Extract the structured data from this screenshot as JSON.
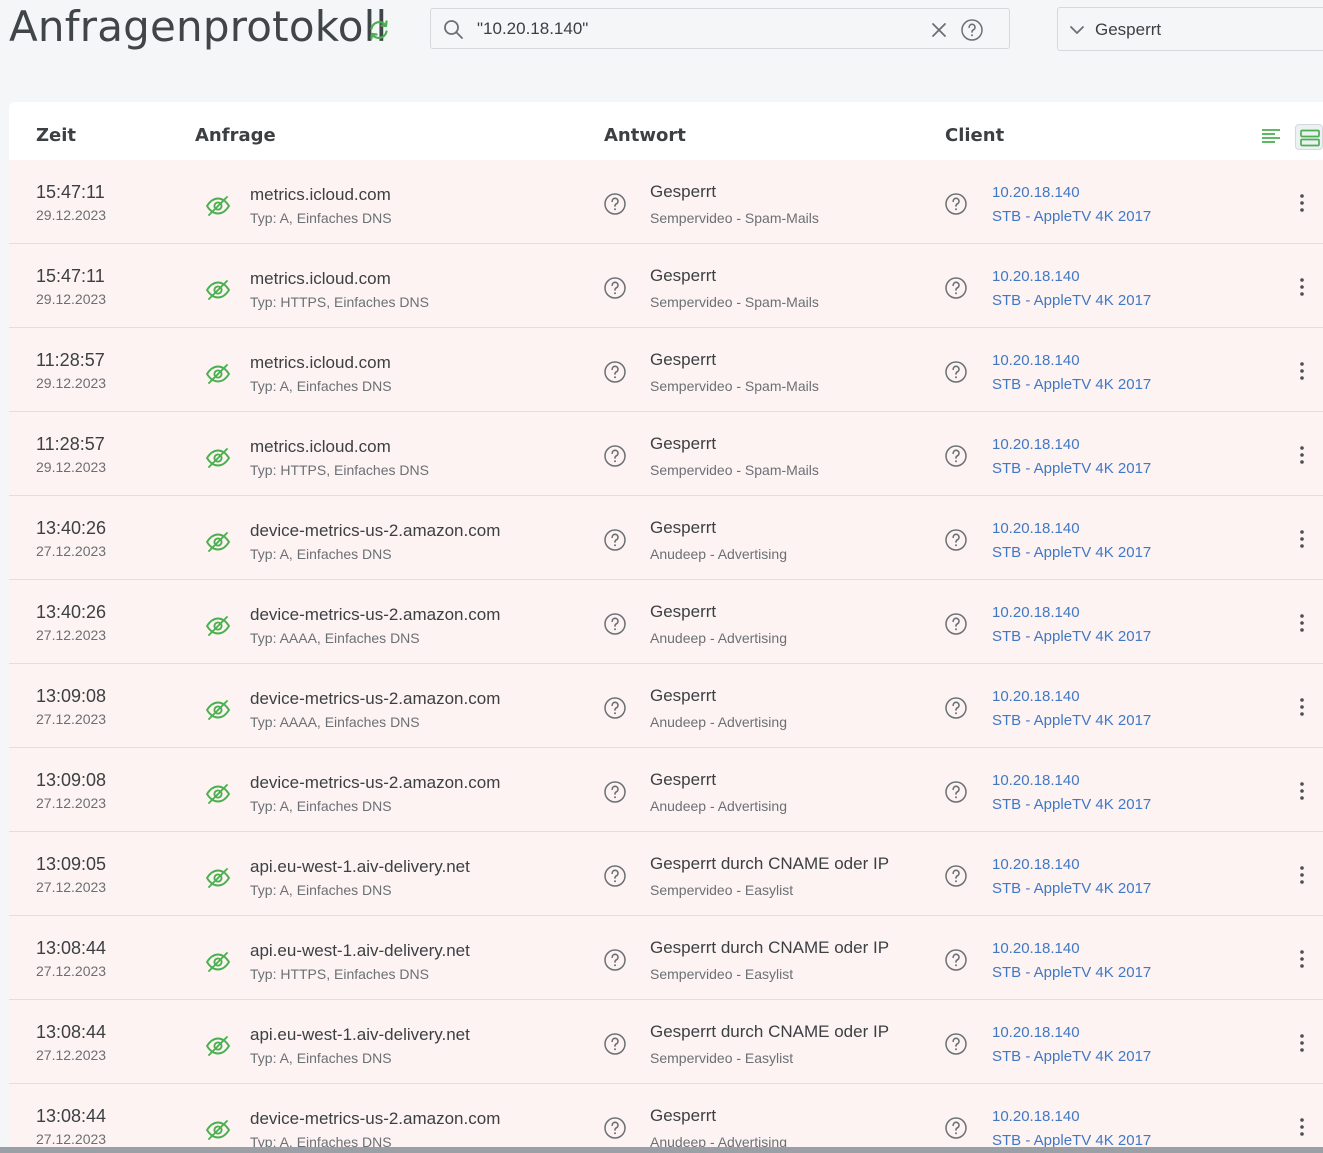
{
  "header": {
    "title": "Anfragenprotokoll",
    "search_value": "\"10.20.18.140\"",
    "filter_value": "Gesperrt",
    "accent_color": "#4caf50"
  },
  "table": {
    "columns": [
      "Zeit",
      "Anfrage",
      "Antwort",
      "Client"
    ],
    "rows": [
      {
        "time": "15:47:11",
        "date": "29.12.2023",
        "domain": "metrics.icloud.com",
        "type": "Typ: A, Einfaches DNS",
        "status": "Gesperrt",
        "list": "Sempervideo - Spam-Mails",
        "ip": "10.20.18.140",
        "client": "STB - AppleTV 4K 2017"
      },
      {
        "time": "15:47:11",
        "date": "29.12.2023",
        "domain": "metrics.icloud.com",
        "type": "Typ: HTTPS, Einfaches DNS",
        "status": "Gesperrt",
        "list": "Sempervideo - Spam-Mails",
        "ip": "10.20.18.140",
        "client": "STB - AppleTV 4K 2017"
      },
      {
        "time": "11:28:57",
        "date": "29.12.2023",
        "domain": "metrics.icloud.com",
        "type": "Typ: A, Einfaches DNS",
        "status": "Gesperrt",
        "list": "Sempervideo - Spam-Mails",
        "ip": "10.20.18.140",
        "client": "STB - AppleTV 4K 2017"
      },
      {
        "time": "11:28:57",
        "date": "29.12.2023",
        "domain": "metrics.icloud.com",
        "type": "Typ: HTTPS, Einfaches DNS",
        "status": "Gesperrt",
        "list": "Sempervideo - Spam-Mails",
        "ip": "10.20.18.140",
        "client": "STB - AppleTV 4K 2017"
      },
      {
        "time": "13:40:26",
        "date": "27.12.2023",
        "domain": "device-metrics-us-2.amazon.com",
        "type": "Typ: A, Einfaches DNS",
        "status": "Gesperrt",
        "list": "Anudeep - Advertising",
        "ip": "10.20.18.140",
        "client": "STB - AppleTV 4K 2017"
      },
      {
        "time": "13:40:26",
        "date": "27.12.2023",
        "domain": "device-metrics-us-2.amazon.com",
        "type": "Typ: AAAA, Einfaches DNS",
        "status": "Gesperrt",
        "list": "Anudeep - Advertising",
        "ip": "10.20.18.140",
        "client": "STB - AppleTV 4K 2017"
      },
      {
        "time": "13:09:08",
        "date": "27.12.2023",
        "domain": "device-metrics-us-2.amazon.com",
        "type": "Typ: AAAA, Einfaches DNS",
        "status": "Gesperrt",
        "list": "Anudeep - Advertising",
        "ip": "10.20.18.140",
        "client": "STB - AppleTV 4K 2017"
      },
      {
        "time": "13:09:08",
        "date": "27.12.2023",
        "domain": "device-metrics-us-2.amazon.com",
        "type": "Typ: A, Einfaches DNS",
        "status": "Gesperrt",
        "list": "Anudeep - Advertising",
        "ip": "10.20.18.140",
        "client": "STB - AppleTV 4K 2017"
      },
      {
        "time": "13:09:05",
        "date": "27.12.2023",
        "domain": "api.eu-west-1.aiv-delivery.net",
        "type": "Typ: A, Einfaches DNS",
        "status": "Gesperrt durch CNAME oder IP",
        "list": "Sempervideo - Easylist",
        "ip": "10.20.18.140",
        "client": "STB - AppleTV 4K 2017"
      },
      {
        "time": "13:08:44",
        "date": "27.12.2023",
        "domain": "api.eu-west-1.aiv-delivery.net",
        "type": "Typ: HTTPS, Einfaches DNS",
        "status": "Gesperrt durch CNAME oder IP",
        "list": "Sempervideo - Easylist",
        "ip": "10.20.18.140",
        "client": "STB - AppleTV 4K 2017"
      },
      {
        "time": "13:08:44",
        "date": "27.12.2023",
        "domain": "api.eu-west-1.aiv-delivery.net",
        "type": "Typ: A, Einfaches DNS",
        "status": "Gesperrt durch CNAME oder IP",
        "list": "Sempervideo - Easylist",
        "ip": "10.20.18.140",
        "client": "STB - AppleTV 4K 2017"
      },
      {
        "time": "13:08:44",
        "date": "27.12.2023",
        "domain": "device-metrics-us-2.amazon.com",
        "type": "Typ: A, Einfaches DNS",
        "status": "Gesperrt",
        "list": "Anudeep - Advertising",
        "ip": "10.20.18.140",
        "client": "STB - AppleTV 4K 2017"
      }
    ]
  }
}
